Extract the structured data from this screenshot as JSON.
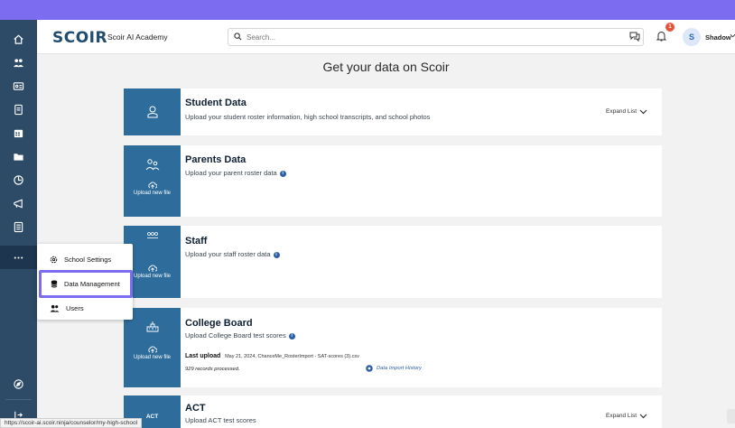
{
  "app": {
    "logo": "SCOIR",
    "org_name": "Scoir AI Academy"
  },
  "search": {
    "placeholder": "Search..."
  },
  "header": {
    "notification_count": "1",
    "avatar_initial": "S",
    "user_name": "Shadow"
  },
  "page": {
    "title": "Get your data on Scoir"
  },
  "cards": [
    {
      "title": "Student Data",
      "description": "Upload your student roster information, high school transcripts, and school photos",
      "expand": "Expand List",
      "icon": "student-icon"
    },
    {
      "title": "Parents Data",
      "description": "Upload your parent roster data",
      "info": "i",
      "upload": "Upload new file",
      "icon": "parents-icon"
    },
    {
      "title": "Staff",
      "description": "Upload your staff roster data",
      "info": "i",
      "upload": "Upload new file",
      "icon": "staff-icon"
    },
    {
      "title": "College Board",
      "description": "Upload College Board test scores",
      "info": "i",
      "upload": "Upload new file",
      "icon": "college-icon",
      "last_upload_label": "Last upload",
      "last_upload_value": "May 21, 2024, ChanceMe_RosterImport - SAT-scores (3).csv",
      "records": "929 records processed.",
      "history_link": "Data Import History"
    },
    {
      "title": "ACT",
      "description": "Upload ACT test scores",
      "expand": "Expand List",
      "side_label": "ACT"
    }
  ],
  "menu": {
    "items": [
      {
        "label": "School Settings",
        "icon": "gear-icon"
      },
      {
        "label": "Data Management",
        "icon": "database-icon"
      },
      {
        "label": "Users",
        "icon": "users-icon"
      }
    ]
  },
  "status_url": "https://scoir-ai.scoir.ninja/counselor/my-high-school",
  "sidebar": {
    "icons": [
      "home-icon",
      "students-icon",
      "id-card-icon",
      "document-icon",
      "calendar-icon",
      "folder-icon",
      "college-icon",
      "megaphone-icon",
      "list-icon",
      "more-icon",
      "compass-icon",
      "expand-icon"
    ]
  },
  "colors": {
    "accent": "#7b6cf0",
    "sidebar": "#2d4a66",
    "card_side": "#2e6d9b",
    "badge": "#e3533a"
  }
}
